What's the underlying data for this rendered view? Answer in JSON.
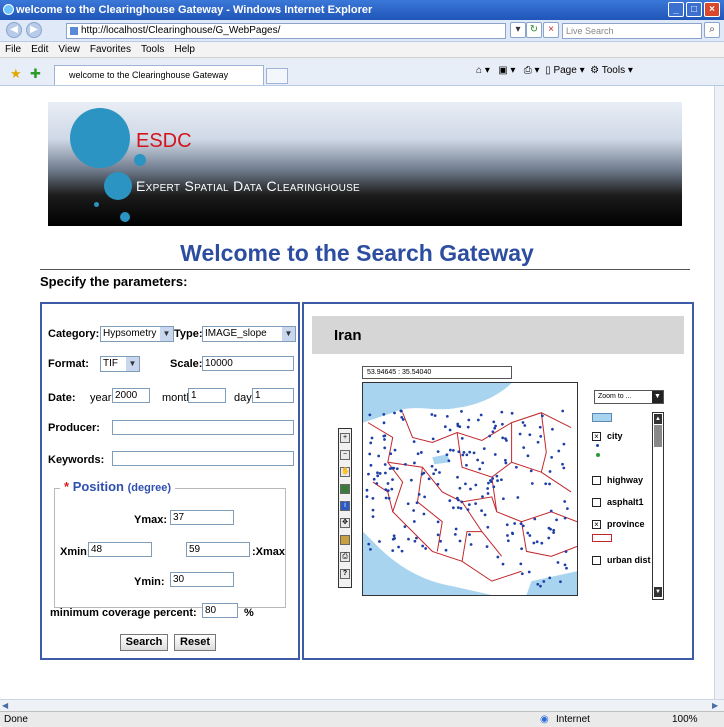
{
  "window": {
    "title": "welcome to the Clearinghouse Gateway - Windows Internet Explorer"
  },
  "address": {
    "url": "http://localhost/Clearinghouse/G_WebPages/",
    "search_placeholder": "Live Search"
  },
  "menu": [
    "File",
    "Edit",
    "View",
    "Favorites",
    "Tools",
    "Help"
  ],
  "tab": {
    "label": "welcome to the Clearinghouse Gateway"
  },
  "toolbar": {
    "page": "Page",
    "tools": "Tools"
  },
  "banner": {
    "title": "ESDC",
    "subtitle": "Expert Spatial Data Clearinghouse"
  },
  "heading": "Welcome to the Search Gateway",
  "subheading": "Specify the parameters:",
  "form": {
    "category_label": "Category:",
    "category_value": "Hypsometry",
    "type_label": "Type:",
    "type_value": "IMAGE_slope",
    "format_label": "Format:",
    "format_value": "TIF",
    "scale_label": "Scale:",
    "scale_value": "10000",
    "date_label": "Date:",
    "year_label": "year",
    "year_value": "2000",
    "month_label": "month",
    "month_value": "1",
    "day_label": "day",
    "day_value": "1",
    "producer_label": "Producer:",
    "producer_value": "",
    "keywords_label": "Keywords:",
    "keywords_value": "",
    "position_star": "*",
    "position_title": "Position",
    "position_unit": "(degree)",
    "ymax_label": "Ymax:",
    "ymax_value": "37",
    "xmin_label": "Xmin:",
    "xmin_value": "48",
    "xmax_label": ":Xmax",
    "xmax_value": "59",
    "ymin_label": "Ymin:",
    "ymin_value": "30",
    "coverage_label": "minimum coverage percent:",
    "coverage_value": "80",
    "coverage_unit": "%",
    "search_button": "Search",
    "reset_button": "Reset"
  },
  "map": {
    "title": "Iran",
    "coords": "53.94645 : 35.54040",
    "zoom_select": "Zoom to ...",
    "legend": [
      {
        "label": "",
        "state": "swatch-blue"
      },
      {
        "label": "city",
        "state": "checked"
      },
      {
        "label": "highway",
        "state": "unchecked"
      },
      {
        "label": "asphalt1",
        "state": "unchecked"
      },
      {
        "label": "province",
        "state": "checked"
      },
      {
        "label": "urban dist",
        "state": "unchecked"
      }
    ],
    "colors": {
      "water": "#a9d4f0",
      "boundary": "#c0262c",
      "city": "#1f3fa8",
      "land": "#ffffff"
    }
  },
  "status": {
    "left": "Done",
    "zone": "Internet",
    "zoom": "100%"
  }
}
